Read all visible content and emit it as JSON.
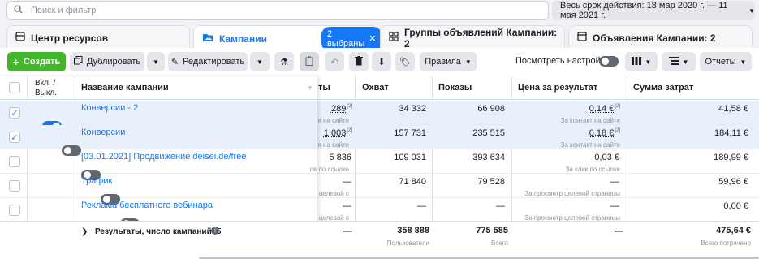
{
  "search": {
    "placeholder": "Поиск и фильтр"
  },
  "date_range": "Весь срок действия: 18 мар 2020 г. — 11 мая 2021 г.",
  "tabs": {
    "resources": "Центр ресурсов",
    "campaigns": "Кампании",
    "selected_badge": "2 выбраны",
    "adsets": "Группы объявлений Кампании: 2",
    "ads": "Объявления Кампании: 2"
  },
  "toolbar": {
    "create": "Создать",
    "duplicate": "Дублировать",
    "edit": "Редактировать",
    "rules": "Правила",
    "view_settings": "Посмотреть настройки",
    "reports": "Отчеты"
  },
  "columns": {
    "onoff": "Вкл. / Выкл.",
    "name": "Название кампании",
    "results": "ты",
    "reach": "Охват",
    "impressions": "Показы",
    "cost_per_result": "Цена за результат",
    "amount_spent": "Сумма затрат"
  },
  "rows": [
    {
      "name": "Конверсии - 2",
      "selected": true,
      "active": true,
      "results": "289",
      "results_note": "[2]",
      "results_sub": "я на сайте",
      "reach": "34 332",
      "impressions": "66 908",
      "cpr": "0,14 €",
      "cpr_note": "[2]",
      "cpr_sub": "За контакт на сайте",
      "spent": "41,58 €"
    },
    {
      "name": "Конверсии",
      "selected": true,
      "active": false,
      "results": "1 003",
      "results_note": "[2]",
      "results_sub": "я на сайте",
      "reach": "157 731",
      "impressions": "235 515",
      "cpr": "0,18 €",
      "cpr_note": "[2]",
      "cpr_sub": "За контакт на сайте",
      "spent": "184,11 €"
    },
    {
      "name": "[03.01.2021] Продвижение deisei.de/free",
      "selected": false,
      "active": false,
      "results": "5 836",
      "results_note": "",
      "results_sub": "ов по ссылке",
      "reach": "109 031",
      "impressions": "393 634",
      "cpr": "0,03 €",
      "cpr_note": "",
      "cpr_sub": "За клик по ссылке",
      "spent": "189,99 €"
    },
    {
      "name": "Трафик",
      "selected": false,
      "active": false,
      "results": "—",
      "results_note": "",
      "results_sub": "целевой с",
      "reach": "71 840",
      "impressions": "79 528",
      "cpr": "—",
      "cpr_note": "",
      "cpr_sub": "За просмотр целевой страницы",
      "spent": "59,96 €"
    },
    {
      "name": "Реклама бесплатного вебинара",
      "selected": false,
      "active": false,
      "results": "—",
      "results_note": "",
      "results_sub": "целевой с",
      "reach": "—",
      "impressions": "—",
      "cpr": "—",
      "cpr_note": "",
      "cpr_sub": "За просмотр целевой страницы",
      "spent": "0,00 €"
    }
  ],
  "footer": {
    "label": "Результаты, число кампаний: 5",
    "results": "—",
    "reach": "358 888",
    "reach_sub": "Пользователи",
    "impressions": "775 585",
    "impressions_sub": "Всего",
    "cpr": "—",
    "spent": "475,64 €",
    "spent_sub": "Всего потрачено"
  },
  "colors": {
    "accent": "#1877f2",
    "create": "#42b72a",
    "selected_row": "#e7f0fb"
  }
}
